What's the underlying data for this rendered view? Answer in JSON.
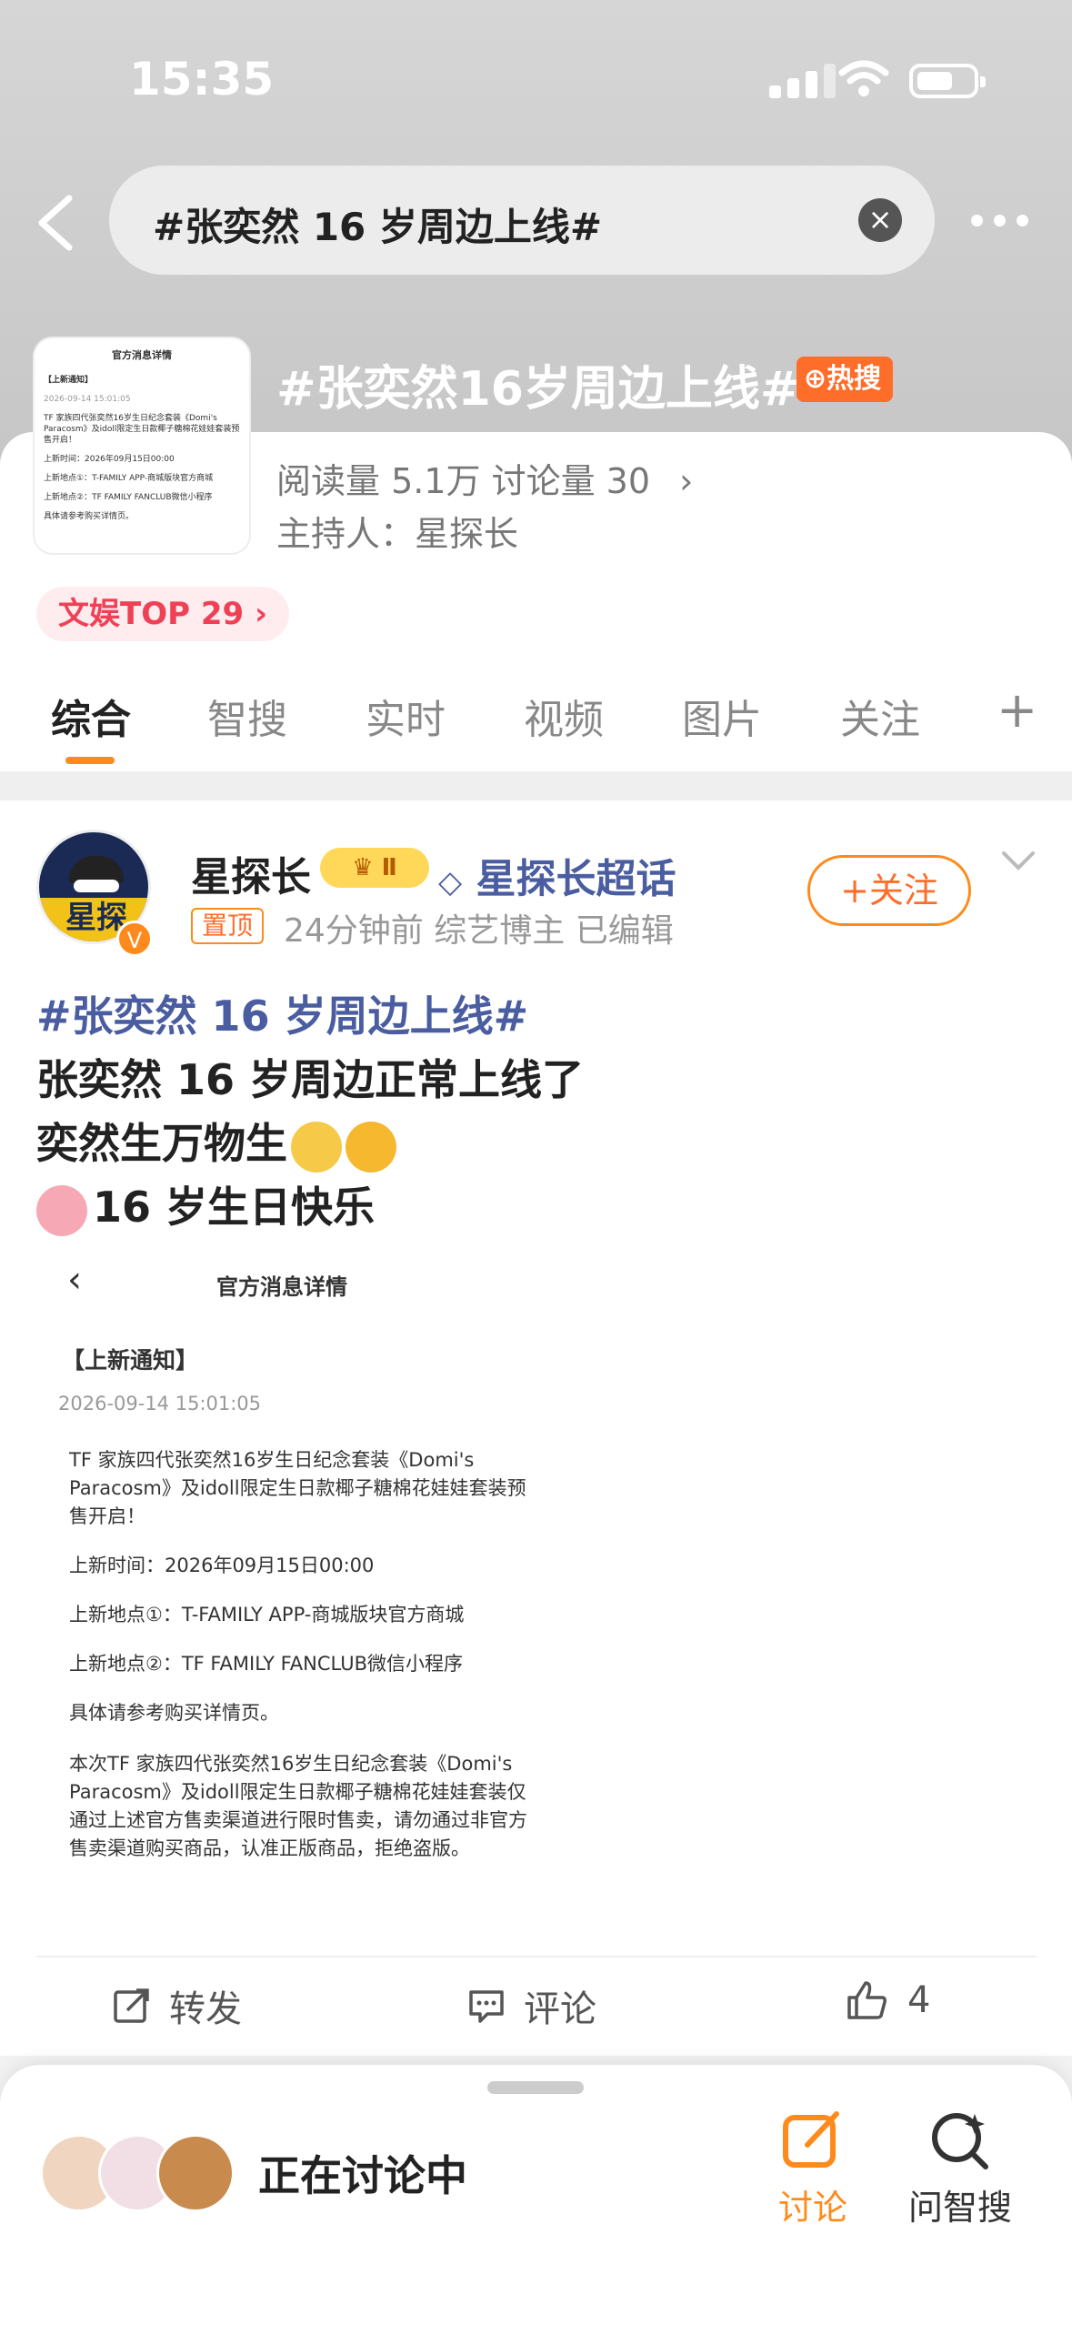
{
  "status_bar": {
    "time": "15:35"
  },
  "search": {
    "query": "#张奕然 16 岁周边上线#"
  },
  "topic": {
    "title": "#张奕然16岁周边上线#",
    "hot_badge": "热搜",
    "stats": "阅读量 5.1万  讨论量 30",
    "host_label": "主持人：",
    "host_name": "星探长",
    "rank_badge": "文娱TOP 29",
    "thumb": {
      "header": "官方消息详情",
      "notice": "【上新通知】",
      "date": "2026-09-14 15:01:05",
      "line1": "TF 家族四代张奕然16岁生日纪念套装《Domi's Paracosm》及idoll限定生日款椰子糖棉花娃娃套装预售开启！",
      "line2": "上新时间：2026年09月15日00:00",
      "line3": "上新地点①：T-FAMILY APP-商城版块官方商城",
      "line4": "上新地点②：TF FAMILY FANCLUB微信小程序",
      "line5": "具体请参考购买详情页。"
    }
  },
  "tabs": [
    {
      "label": "综合"
    },
    {
      "label": "智搜"
    },
    {
      "label": "实时"
    },
    {
      "label": "视频"
    },
    {
      "label": "图片"
    },
    {
      "label": "关注"
    },
    {
      "label": "+"
    }
  ],
  "post": {
    "author": "星探长",
    "level": "Ⅱ",
    "supertopic": "星探长超话",
    "pin_label": "置顶",
    "meta": "24分钟前  综艺博主  已编辑",
    "follow_label": "+关注",
    "avatar_text": "星探",
    "verified": "V",
    "hashtag": "#张奕然 16 岁周边上线#",
    "line1": "张奕然 16 岁周边正常上线了",
    "line2": "奕然生万物生",
    "line3": "16 岁生日快乐",
    "image": {
      "header": "官方消息详情",
      "notice": "【上新通知】",
      "date": "2026-09-14 15:01:05",
      "p1": "TF 家族四代张奕然16岁生日纪念套装《Domi's Paracosm》及idoll限定生日款椰子糖棉花娃娃套装预售开启！",
      "p2": "上新时间：2026年09月15日00:00",
      "p3": "上新地点①：T-FAMILY APP-商城版块官方商城",
      "p4": "上新地点②：TF FAMILY FANCLUB微信小程序",
      "p5": "具体请参考购买详情页。",
      "p6": "本次TF 家族四代张奕然16岁生日纪念套装《Domi's Paracosm》及idoll限定生日款椰子糖棉花娃娃套装仅通过上述官方售卖渠道进行限时售卖，请勿通过非官方售卖渠道购买商品，认准正版商品，拒绝盗版。"
    },
    "actions": {
      "repost": "转发",
      "comment": "评论",
      "likes": "4"
    }
  },
  "bottom_bar": {
    "discussing": "正在讨论中",
    "discuss_label": "讨论",
    "ask_label": "问智搜"
  },
  "colors": {
    "accent": "#ff8a1c",
    "link": "#4a5da0",
    "hot": "#ff6d2a"
  }
}
